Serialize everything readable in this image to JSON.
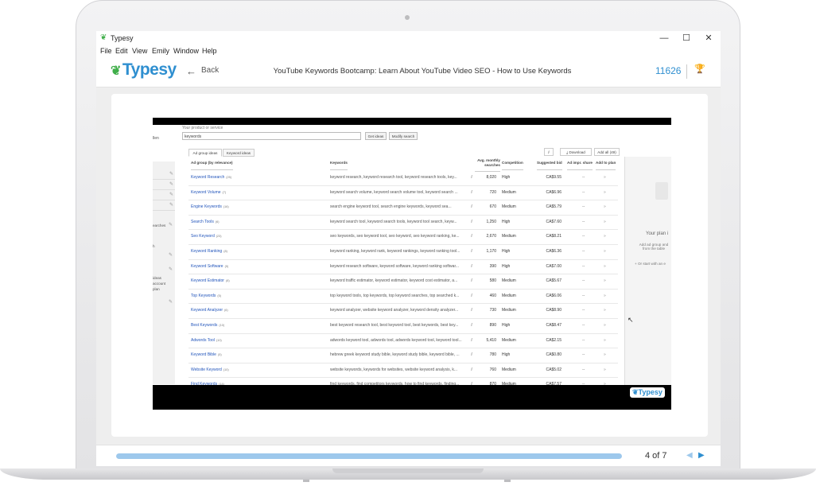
{
  "window": {
    "app_name": "Typesy",
    "controls": {
      "minimize": "—",
      "maximize": "☐",
      "close": "✕"
    }
  },
  "menu": [
    "File",
    "Edit",
    "View",
    "Emily",
    "Window",
    "Help"
  ],
  "header": {
    "logo": "Typesy",
    "back_label": "Back",
    "course_title": "YouTube Keywords Bootcamp: Learn About YouTube Video SEO - How to Use Keywords",
    "points": "11626"
  },
  "video": {
    "watermark": "Typesy",
    "search": {
      "label": "Your product or service",
      "value": "keywords",
      "get_ideas": "Get ideas",
      "modify_search": "Modify search",
      "left_label": "llen"
    },
    "left_panel_texts": [
      "earches",
      "h",
      "ideas",
      "account",
      "plan"
    ],
    "tabs": [
      "Ad group ideas",
      "Keyword ideas"
    ],
    "actions": {
      "download": "Download",
      "add_all": "Add all (49)"
    },
    "columns": {
      "ad_group": "Ad group (by relevance)",
      "keywords": "Keywords",
      "avg": "Avg. monthly searches",
      "competition": "Competition",
      "bid": "Suggested bid",
      "share": "Ad impr. share",
      "add": "Add to plan"
    },
    "rows": [
      {
        "ad_group": "Keyword Research",
        "count": "(25)",
        "keywords": "keyword research, keyword research tool, keyword research tools, key...",
        "avg": "8,020",
        "comp": "High",
        "bid": "CA$9.55"
      },
      {
        "ad_group": "Keyword Volume",
        "count": "(7)",
        "keywords": "keyword search volume, keyword search volume tool, keyword search ...",
        "avg": "720",
        "comp": "Medium",
        "bid": "CA$6.96"
      },
      {
        "ad_group": "Engine Keywords",
        "count": "(16)",
        "keywords": "search engine keyword tool, search engine keywords, keyword sea...",
        "avg": "670",
        "comp": "Medium",
        "bid": "CA$5.79"
      },
      {
        "ad_group": "Search Tools",
        "count": "(6)",
        "keywords": "keyword search tool, keyword search tools, keyword tool search, keyw...",
        "avg": "1,250",
        "comp": "High",
        "bid": "CA$7.60"
      },
      {
        "ad_group": "Seo Keyword",
        "count": "(23)",
        "keywords": "seo keywords, seo keyword tool, seo keyword, seo keyword ranking, ke...",
        "avg": "2,670",
        "comp": "Medium",
        "bid": "CA$8.21"
      },
      {
        "ad_group": "Keyword Ranking",
        "count": "(8)",
        "keywords": "keyword ranking, keyword rank, keyword rankings, keyword ranking tool...",
        "avg": "1,170",
        "comp": "High",
        "bid": "CA$6.36"
      },
      {
        "ad_group": "Keyword Software",
        "count": "(5)",
        "keywords": "keyword research software, keyword software, keyword ranking softwar...",
        "avg": "390",
        "comp": "High",
        "bid": "CA$7.00"
      },
      {
        "ad_group": "Keyword Estimator",
        "count": "(8)",
        "keywords": "keyword traffic estimator, keyword estimator, keyword cost estimator, a...",
        "avg": "580",
        "comp": "Medium",
        "bid": "CA$5.67"
      },
      {
        "ad_group": "Top Keywords",
        "count": "(5)",
        "keywords": "top keyword tools, top keywords, top keyword searches, top searched k...",
        "avg": "460",
        "comp": "Medium",
        "bid": "CA$6.06"
      },
      {
        "ad_group": "Keyword Analyzer",
        "count": "(6)",
        "keywords": "keyword analyzer, website keyword analyzer, keyword density analyzer...",
        "avg": "730",
        "comp": "Medium",
        "bid": "CA$8.90"
      },
      {
        "ad_group": "Best Keywords",
        "count": "(10)",
        "keywords": "best keyword research tool, best keyword tool, best keywords, best key...",
        "avg": "890",
        "comp": "High",
        "bid": "CA$8.47"
      },
      {
        "ad_group": "Adwords Tool",
        "count": "(10)",
        "keywords": "adwords keyword tool, adwords tool, adwords keyword tool, keyword tool...",
        "avg": "5,410",
        "comp": "Medium",
        "bid": "CA$2.15"
      },
      {
        "ad_group": "Keyword Bible",
        "count": "(5)",
        "keywords": "hebrew greek keyword study bible, keyword study bible, keyword bible, ...",
        "avg": "780",
        "comp": "High",
        "bid": "CA$0.80"
      },
      {
        "ad_group": "Website Keyword",
        "count": "(10)",
        "keywords": "website keywords, keywords for websites, website keyword analysis, k...",
        "avg": "760",
        "comp": "Medium",
        "bid": "CA$5.02"
      },
      {
        "ad_group": "Find Keywords",
        "count": "(14)",
        "keywords": "find keywords, find competitors keywords, how to find keywords, finding...",
        "avg": "870",
        "comp": "Medium",
        "bid": "CA$7.57"
      }
    ],
    "row_dash": "--",
    "row_add": "»",
    "right_panel": {
      "title": "Your plan i",
      "text": "Add ad group and from the table",
      "text2": "+ Or start with an e"
    }
  },
  "footer": {
    "progress": 1.0,
    "page_indicator": "4 of 7"
  },
  "colors": {
    "brand_blue": "#2f8fd0",
    "brand_green": "#3fae49",
    "progress": "#9dc8ec"
  }
}
